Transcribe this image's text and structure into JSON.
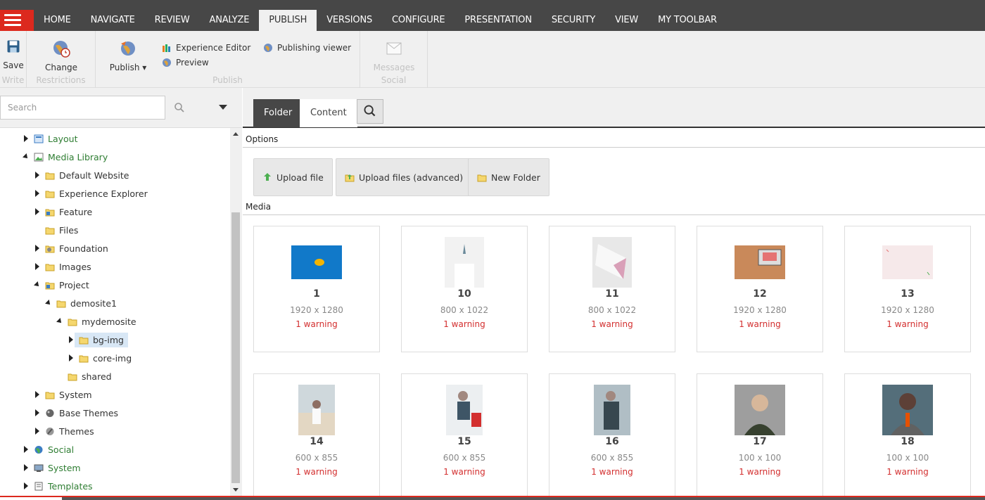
{
  "nav": {
    "tabs": [
      {
        "label": "HOME"
      },
      {
        "label": "NAVIGATE"
      },
      {
        "label": "REVIEW"
      },
      {
        "label": "ANALYZE"
      },
      {
        "label": "PUBLISH"
      },
      {
        "label": "VERSIONS"
      },
      {
        "label": "CONFIGURE"
      },
      {
        "label": "PRESENTATION"
      },
      {
        "label": "SECURITY"
      },
      {
        "label": "VIEW"
      },
      {
        "label": "MY TOOLBAR"
      }
    ],
    "active_tab": "PUBLISH",
    "accent_color": "#dc291e"
  },
  "ribbon": {
    "write": {
      "save": "Save",
      "group": "Write"
    },
    "restrictions": {
      "change": "Change",
      "group": "Restrictions"
    },
    "publish": {
      "publish": "Publish",
      "experience_editor": "Experience Editor",
      "preview": "Preview",
      "publishing_viewer": "Publishing viewer",
      "group": "Publish"
    },
    "social": {
      "messages": "Messages",
      "group": "Social"
    }
  },
  "search": {
    "placeholder": "Search"
  },
  "tree": {
    "items": [
      {
        "label": "Layout",
        "icon": "layout-icon"
      },
      {
        "label": "Media Library",
        "icon": "media-library-icon"
      },
      {
        "label": "Default Website",
        "icon": "folder-icon"
      },
      {
        "label": "Experience Explorer",
        "icon": "folder-icon"
      },
      {
        "label": "Feature",
        "icon": "feature-icon"
      },
      {
        "label": "Files",
        "icon": "folder-icon"
      },
      {
        "label": "Foundation",
        "icon": "foundation-icon"
      },
      {
        "label": "Images",
        "icon": "folder-icon"
      },
      {
        "label": "Project",
        "icon": "project-icon"
      },
      {
        "label": "demosite1",
        "icon": "folder-icon"
      },
      {
        "label": "mydemosite",
        "icon": "folder-icon"
      },
      {
        "label": "bg-img",
        "icon": "folder-icon"
      },
      {
        "label": "core-img",
        "icon": "folder-icon"
      },
      {
        "label": "shared",
        "icon": "folder-icon"
      },
      {
        "label": "System",
        "icon": "folder-icon"
      },
      {
        "label": "Base Themes",
        "icon": "base-themes-icon"
      },
      {
        "label": "Themes",
        "icon": "themes-icon"
      },
      {
        "label": "Social",
        "icon": "social-icon"
      },
      {
        "label": "System",
        "icon": "system-icon"
      },
      {
        "label": "Templates",
        "icon": "templates-icon"
      }
    ]
  },
  "main": {
    "tabs": {
      "folder": "Folder",
      "content": "Content"
    },
    "options_title": "Options",
    "media_title": "Media",
    "buttons": {
      "upload_file": "Upload file",
      "upload_advanced": "Upload files (advanced)",
      "new_folder": "New Folder"
    },
    "cards": [
      {
        "name": "1",
        "dims": "1920 x 1280",
        "warning": "1 warning"
      },
      {
        "name": "10",
        "dims": "800 x 1022",
        "warning": "1 warning"
      },
      {
        "name": "11",
        "dims": "800 x 1022",
        "warning": "1 warning"
      },
      {
        "name": "12",
        "dims": "1920 x 1280",
        "warning": "1 warning"
      },
      {
        "name": "13",
        "dims": "1920 x 1280",
        "warning": "1 warning"
      },
      {
        "name": "14",
        "dims": "600 x 855",
        "warning": "1 warning"
      },
      {
        "name": "15",
        "dims": "600 x 855",
        "warning": "1 warning"
      },
      {
        "name": "16",
        "dims": "600 x 855",
        "warning": "1 warning"
      },
      {
        "name": "17",
        "dims": "100 x 100",
        "warning": "1 warning"
      },
      {
        "name": "18",
        "dims": "100 x 100",
        "warning": "1 warning"
      }
    ]
  }
}
